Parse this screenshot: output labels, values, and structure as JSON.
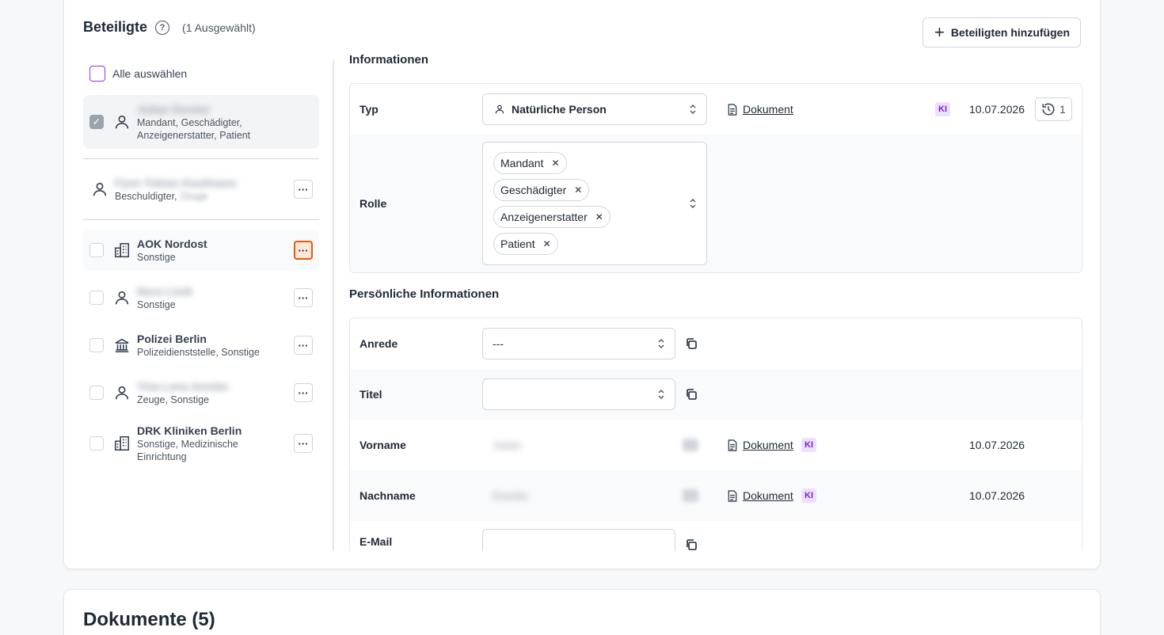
{
  "header": {
    "title": "Beteiligte",
    "selected_count": "(1 Ausgewählt)",
    "add_button": "Beteiligten hinzufügen"
  },
  "left": {
    "select_all": "Alle auswählen",
    "parties": [
      {
        "name": "Julian Drexler",
        "roles": "Mandant, Geschädigter, Anzeigenerstatter, Patient",
        "icon": "person-icon",
        "blurred": true
      },
      {
        "name": "Fynn Tobias Kaufmann",
        "roles": "Beschuldigter,",
        "roles_blurred": "Zeuge",
        "icon": "person-icon",
        "blurred": true
      },
      {
        "name": "AOK Nordost",
        "roles": "Sonstige",
        "icon": "building-icon",
        "blurred": false
      },
      {
        "name": "Nora Lindt",
        "roles": "Sonstige",
        "icon": "person-icon",
        "blurred": true
      },
      {
        "name": "Polizei Berlin",
        "roles": "Polizeidienststelle, Sonstige",
        "icon": "institution-icon",
        "blurred": false
      },
      {
        "name": "Tina Lena Amsler",
        "roles": "Zeuge, Sonstige",
        "icon": "person-icon",
        "blurred": true
      },
      {
        "name": "DRK Kliniken Berlin",
        "roles": "Sonstige, Medizinische Einrichtung",
        "icon": "building-icon",
        "blurred": false
      }
    ]
  },
  "info": {
    "title": "Informationen",
    "typ_label": "Typ",
    "typ_value": "Natürliche Person",
    "doc_label": "Dokument",
    "ki": "KI",
    "date": "10.07.2026",
    "history_count": "1",
    "rolle_label": "Rolle",
    "roles": [
      "Mandant",
      "Geschädigter",
      "Anzeigenerstatter",
      "Patient"
    ]
  },
  "personal": {
    "title": "Persönliche Informationen",
    "anrede_label": "Anrede",
    "anrede_value": "---",
    "titel_label": "Titel",
    "titel_value": "",
    "vorname_label": "Vorname",
    "vorname_value": "Julian",
    "nachname_label": "Nachname",
    "nachname_value": "Drexler",
    "email_label": "E-Mail"
  },
  "documents": {
    "title": "Dokumente (5)"
  },
  "colors": {
    "accent_purple": "#9333ea",
    "ki_bg": "#ede0fb",
    "active_orange": "#ea580c"
  }
}
